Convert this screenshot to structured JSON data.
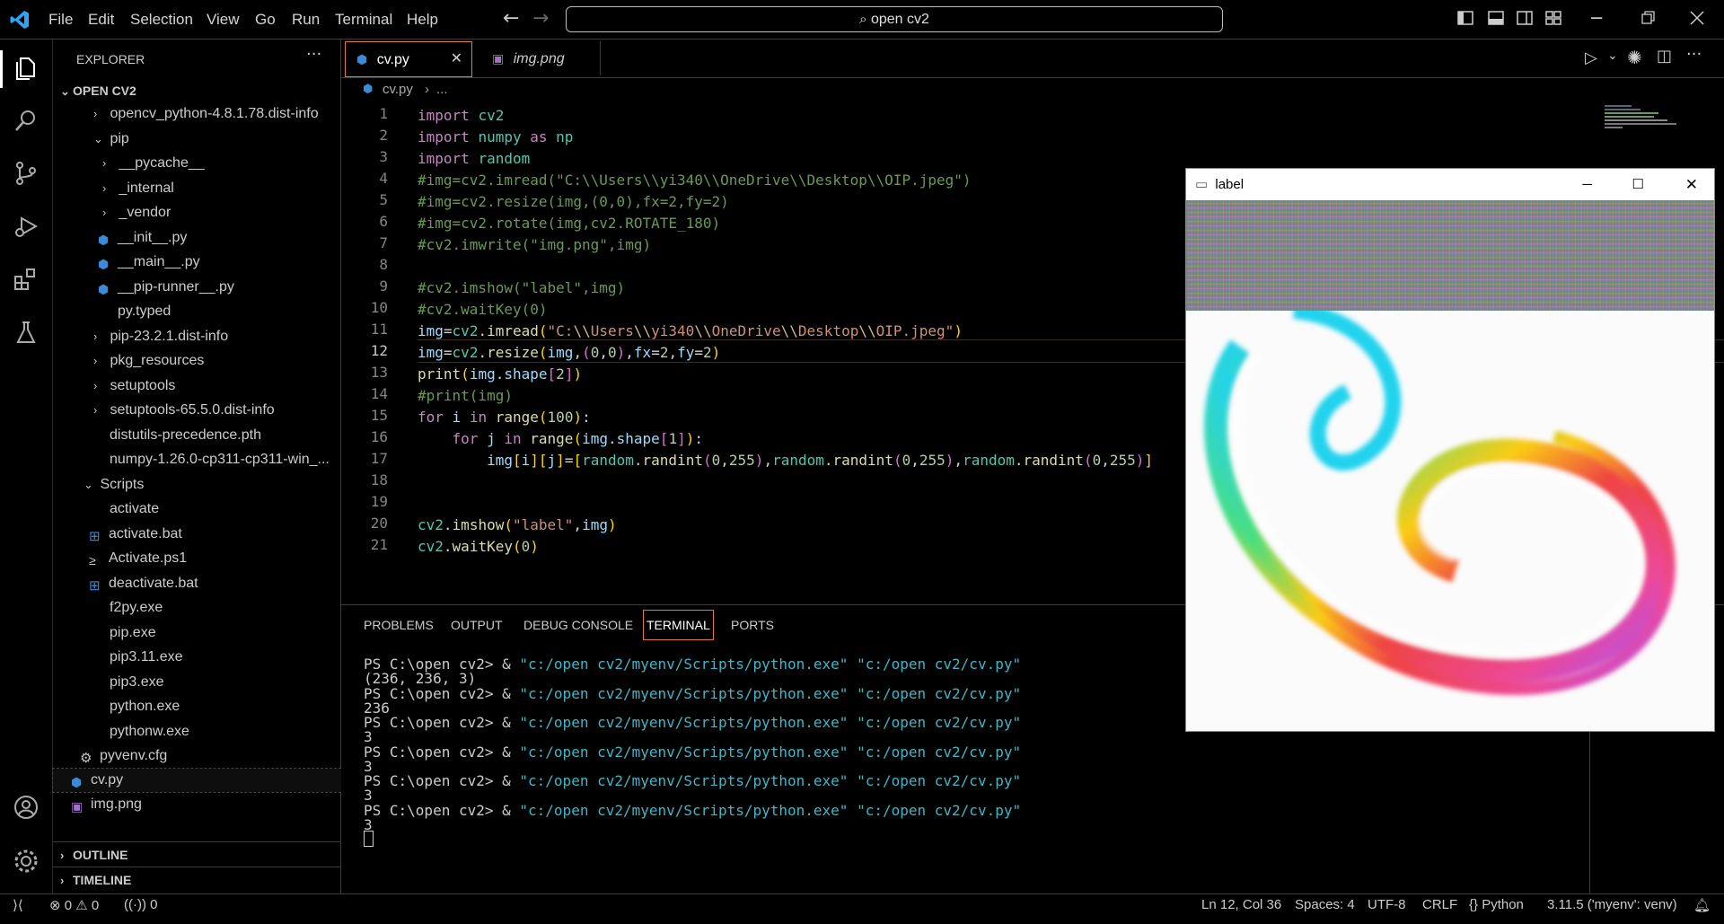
{
  "menu": [
    "File",
    "Edit",
    "Selection",
    "View",
    "Go",
    "Run",
    "Terminal",
    "Help"
  ],
  "search": {
    "text": "open cv2"
  },
  "sidebar": {
    "header": "EXPLORER",
    "root": "OPEN CV2",
    "items": [
      {
        "label": "opencv_python-4.8.1.78.dist-info"
      },
      {
        "label": "pip"
      },
      {
        "label": "__pycache__"
      },
      {
        "label": "_internal"
      },
      {
        "label": "_vendor"
      },
      {
        "label": "__init__.py"
      },
      {
        "label": "__main__.py"
      },
      {
        "label": "__pip-runner__.py"
      },
      {
        "label": "py.typed"
      },
      {
        "label": "pip-23.2.1.dist-info"
      },
      {
        "label": "pkg_resources"
      },
      {
        "label": "setuptools"
      },
      {
        "label": "setuptools-65.5.0.dist-info"
      },
      {
        "label": "distutils-precedence.pth"
      },
      {
        "label": "numpy-1.26.0-cp311-cp311-win_..."
      },
      {
        "label": "Scripts"
      },
      {
        "label": "activate"
      },
      {
        "label": "activate.bat"
      },
      {
        "label": "Activate.ps1"
      },
      {
        "label": "deactivate.bat"
      },
      {
        "label": "f2py.exe"
      },
      {
        "label": "pip.exe"
      },
      {
        "label": "pip3.11.exe"
      },
      {
        "label": "pip3.exe"
      },
      {
        "label": "python.exe"
      },
      {
        "label": "pythonw.exe"
      },
      {
        "label": "pyvenv.cfg"
      },
      {
        "label": "cv.py"
      },
      {
        "label": "img.png"
      }
    ],
    "outline": "OUTLINE",
    "timeline": "TIMELINE"
  },
  "tabs": [
    {
      "label": "cv.py"
    },
    {
      "label": "img.png"
    }
  ],
  "breadcrumb": {
    "file": "cv.py",
    "rest": "..."
  },
  "line_numbers": [
    "1",
    "2",
    "3",
    "4",
    "5",
    "6",
    "7",
    "8",
    "9",
    "10",
    "11",
    "12",
    "13",
    "14",
    "15",
    "16",
    "17",
    "18",
    "19",
    "20",
    "21"
  ],
  "panel": {
    "tabs": [
      "PROBLEMS",
      "OUTPUT",
      "DEBUG CONSOLE",
      "TERMINAL",
      "PORTS"
    ],
    "prompt": "PS C:\\open cv2> & ",
    "cmd_python": "\"c:/open cv2/myenv/Scripts/python.exe\"",
    "cmd_script": "\"c:/open cv2/cv.py\"",
    "outputs": [
      "(236, 236, 3)",
      "236",
      "3",
      "3",
      "3",
      "3"
    ]
  },
  "cvwindow": {
    "title": "label"
  },
  "status": {
    "errors": "0",
    "warnings": "0",
    "ports": "0",
    "position": "Ln 12, Col 36",
    "spaces": "Spaces: 4",
    "encoding": "UTF-8",
    "eol": "CRLF",
    "language": "Python",
    "interpreter": "3.11.5 ('myenv': venv)"
  },
  "colors": {
    "accent": "#0078d4",
    "tab_border": "#e07b39",
    "bg": "#000000"
  }
}
